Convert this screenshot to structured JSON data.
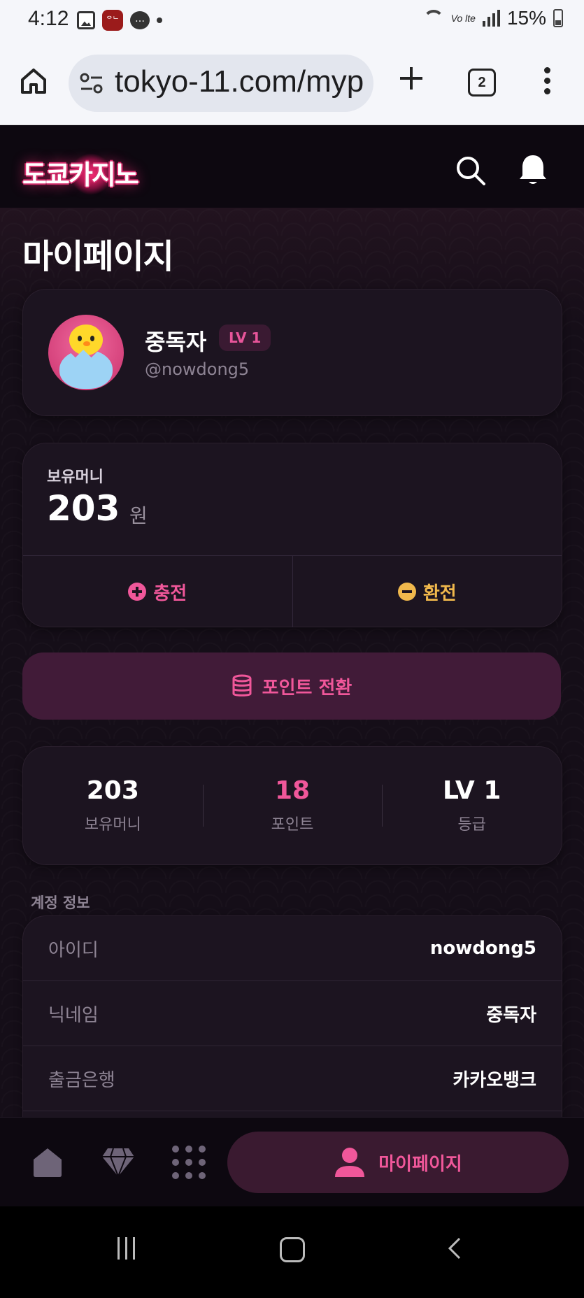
{
  "status_bar": {
    "time": "4:12",
    "app_badge": "ᄋᄂ",
    "battery": "15%",
    "network": "Vo lte"
  },
  "browser": {
    "url": "tokyo-11.com/myp",
    "tab_count": "2"
  },
  "site": {
    "logo_text": "도쿄카지노"
  },
  "page": {
    "title": "마이페이지"
  },
  "profile": {
    "nickname": "중독자",
    "level": "LV 1",
    "username": "@nowdong5"
  },
  "balance": {
    "label": "보유머니",
    "amount": "203",
    "unit": "원",
    "deposit_label": "충전",
    "withdraw_label": "환전"
  },
  "point_convert": {
    "label": "포인트 전환"
  },
  "stats": [
    {
      "value": "203",
      "label": "보유머니"
    },
    {
      "value": "18",
      "label": "포인트"
    },
    {
      "value": "LV 1",
      "label": "등급"
    }
  ],
  "account": {
    "section_label": "계정 정보",
    "rows": [
      {
        "key": "아이디",
        "value": "nowdong5"
      },
      {
        "key": "닉네임",
        "value": "중독자"
      },
      {
        "key": "출금은행",
        "value": "카카오뱅크"
      }
    ]
  },
  "bottom_nav": {
    "mypage_label": "마이페이지"
  },
  "colors": {
    "accent_pink": "#f0579a",
    "accent_gold": "#f0b84c",
    "background": "#150e18"
  }
}
